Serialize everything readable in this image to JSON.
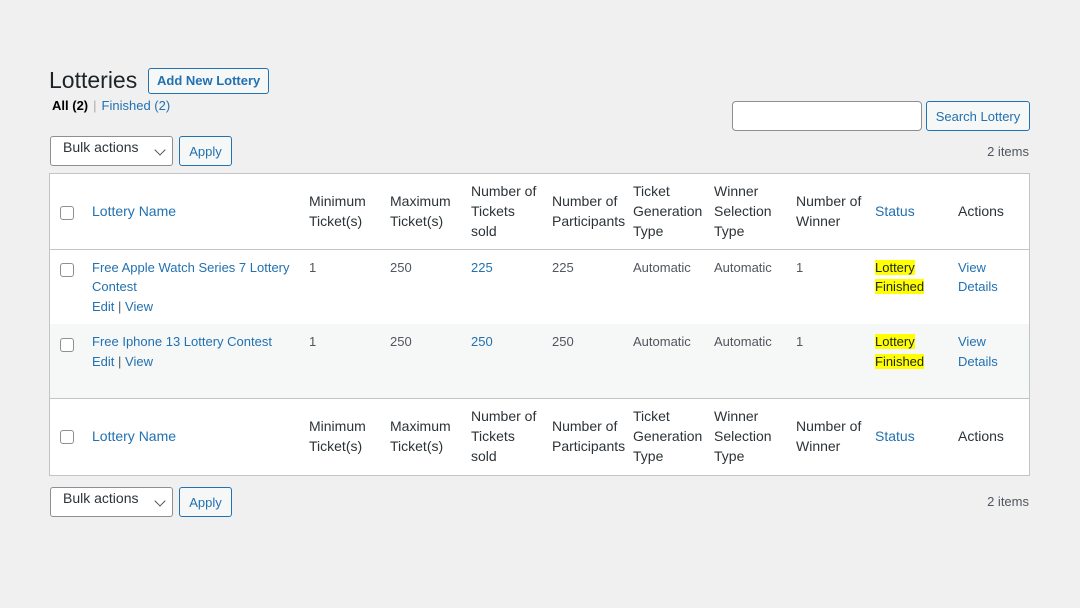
{
  "page": {
    "title": "Lotteries",
    "add_new_label": "Add New Lottery"
  },
  "views": {
    "all_label": "All",
    "all_count": "(2)",
    "separator": "|",
    "finished_label": "Finished (2)"
  },
  "search": {
    "value": "",
    "button_label": "Search Lottery"
  },
  "bulk": {
    "select_label": "Bulk actions",
    "apply_label": "Apply"
  },
  "pagination": {
    "items_text": "2 items"
  },
  "columns": {
    "name": "Lottery Name",
    "min_tickets": "Minimum Ticket(s)",
    "max_tickets": "Maximum Ticket(s)",
    "tickets_sold": "Number of Tickets sold",
    "participants": "Number of Participants",
    "ticket_generation": "Ticket Generation Type",
    "winner_selection": "Winner Selection Type",
    "num_winner": "Number of Winner",
    "status": "Status",
    "actions": "Actions"
  },
  "rows": [
    {
      "name": "Free Apple Watch Series 7 Lottery Contest",
      "edit": "Edit",
      "sep": "|",
      "view": "View",
      "min": "1",
      "max": "250",
      "sold": "225",
      "participants": "225",
      "generation": "Automatic",
      "selection": "Automatic",
      "winners": "1",
      "status_line1": "Lottery",
      "status_line2": "Finished",
      "action_line1": "View",
      "action_line2": "Details"
    },
    {
      "name": "Free Iphone 13 Lottery Contest",
      "edit": "Edit",
      "sep": "|",
      "view": "View",
      "min": "1",
      "max": "250",
      "sold": "250",
      "participants": "250",
      "generation": "Automatic",
      "selection": "Automatic",
      "winners": "1",
      "status_line1": "Lottery",
      "status_line2": "Finished",
      "action_line1": "View",
      "action_line2": "Details"
    }
  ],
  "icons": {
    "select_arrow": "chevron-down-icon",
    "checkbox": "checkbox"
  },
  "colors": {
    "accent": "#2271b1",
    "status_highlight": "#ffff00"
  }
}
